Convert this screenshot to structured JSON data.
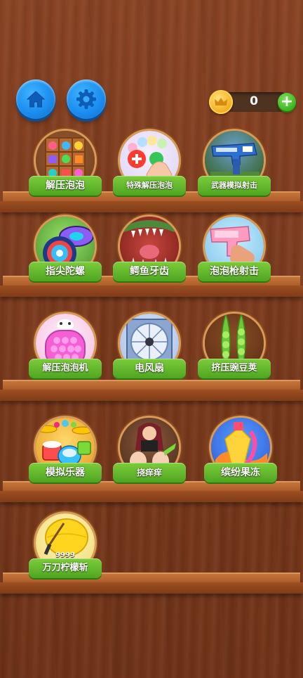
{
  "header": {
    "home_icon": "home-icon",
    "settings_icon": "gear-icon",
    "coins": "0",
    "add_icon": "plus-icon"
  },
  "games": [
    {
      "label": "解压泡泡",
      "icon": "pop-it-shelf-icon"
    },
    {
      "label": "特殊解压泡泡",
      "icon": "bubble-wrap-hand-icon"
    },
    {
      "label": "武器模拟射击",
      "icon": "toy-blaster-icon"
    },
    {
      "label": "指尖陀螺",
      "icon": "spinning-top-icon"
    },
    {
      "label": "鳄鱼牙齿",
      "icon": "crocodile-mouth-icon"
    },
    {
      "label": "泡泡枪射击",
      "icon": "bubble-gun-icon"
    },
    {
      "label": "解压泡泡机",
      "icon": "pop-it-console-icon"
    },
    {
      "label": "电风扇",
      "icon": "electric-fan-icon"
    },
    {
      "label": "挤压豌豆荚",
      "icon": "pea-pod-icon"
    },
    {
      "label": "模拟乐器",
      "icon": "drum-kit-icon"
    },
    {
      "label": "挠痒痒",
      "icon": "tickle-girl-icon"
    },
    {
      "label": "缤纷果冻",
      "icon": "jelly-bottle-icon"
    },
    {
      "label": "万刀柠檬斩",
      "icon": "lemon-knife-icon",
      "badge": "9999"
    }
  ]
}
